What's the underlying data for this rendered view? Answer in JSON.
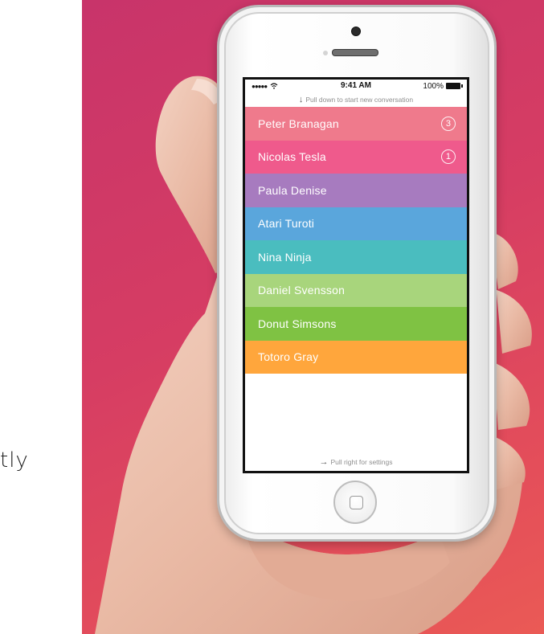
{
  "side_text": "tly",
  "status_bar": {
    "dots": "●●●●●",
    "time": "9:41 AM",
    "battery": "100%"
  },
  "hints": {
    "pull_down": "Pull down to start new conversation",
    "pull_right": "Pull right for settings"
  },
  "contacts": [
    {
      "name": "Peter Branagan",
      "badge": "3",
      "color": "#ef7a8c"
    },
    {
      "name": "Nicolas Tesla",
      "badge": "1",
      "color": "#ef5a8c"
    },
    {
      "name": "Paula Denise",
      "badge": "",
      "color": "#a77bbf"
    },
    {
      "name": "Atari Turoti",
      "badge": "",
      "color": "#5aa6dc"
    },
    {
      "name": "Nina Ninja",
      "badge": "",
      "color": "#4abdbf"
    },
    {
      "name": "Daniel Svensson",
      "badge": "",
      "color": "#a8d57c"
    },
    {
      "name": "Donut Simsons",
      "badge": "",
      "color": "#7fc243"
    },
    {
      "name": "Totoro Gray",
      "badge": "",
      "color": "#ffa63c"
    }
  ]
}
